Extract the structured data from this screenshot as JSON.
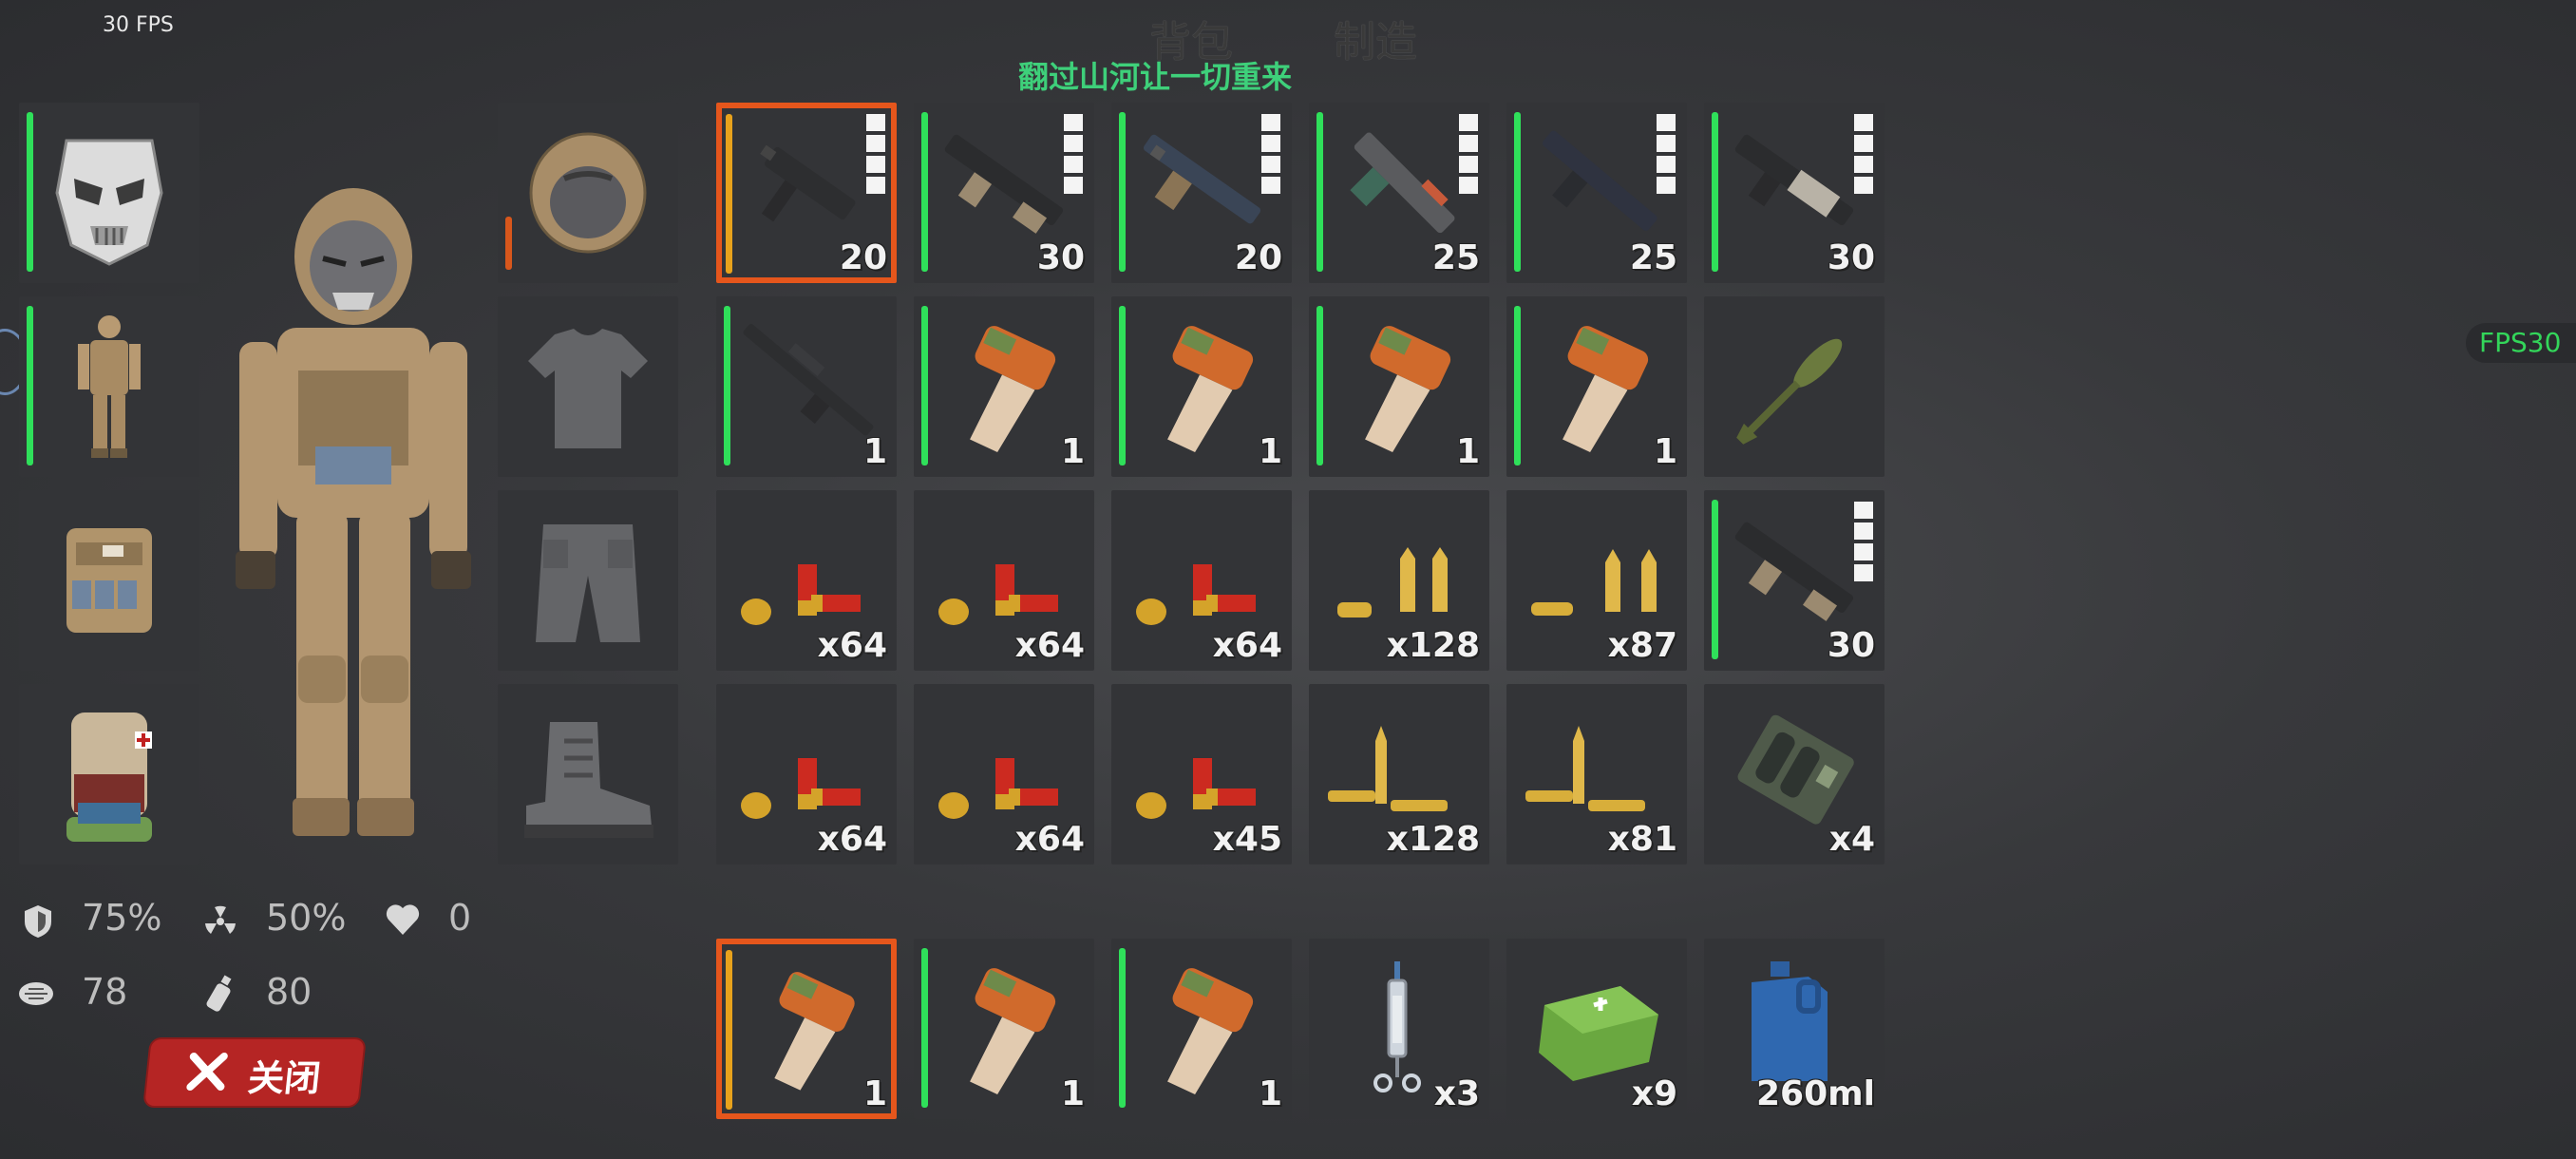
{
  "hud": {
    "fps_top": "30 FPS",
    "fps_right": "FPS30"
  },
  "tabs": {
    "backpack": "背包",
    "crafting": "制造"
  },
  "subtitle": "翻过山河让一切重来",
  "equipment_left": [
    {
      "name": "mask",
      "icon": "skull-mask-icon"
    },
    {
      "name": "suit",
      "icon": "armor-suit-icon"
    },
    {
      "name": "vest",
      "icon": "tactical-vest-icon"
    },
    {
      "name": "backpack",
      "icon": "backpack-icon"
    }
  ],
  "equipment_right": [
    {
      "name": "helmet",
      "icon": "helmet-icon"
    },
    {
      "name": "shirt",
      "icon": "tshirt-icon"
    },
    {
      "name": "pants",
      "icon": "pants-icon"
    },
    {
      "name": "boots",
      "icon": "boot-icon"
    }
  ],
  "stats": {
    "armor": "75%",
    "radiation": "50%",
    "health": "0",
    "food": "78",
    "water": "80"
  },
  "close_button": {
    "label": "关闭"
  },
  "inventory": {
    "row1": [
      "20",
      "30",
      "20",
      "25",
      "25",
      "30"
    ],
    "row2": [
      "1",
      "1",
      "1",
      "1",
      "1",
      ""
    ],
    "row3": [
      "x64",
      "x64",
      "x64",
      "x128",
      "x87",
      "30"
    ],
    "row4": [
      "x64",
      "x64",
      "x45",
      "x128",
      "x81",
      "x4"
    ]
  },
  "hotbar": [
    "1",
    "1",
    "1",
    "x3",
    "x9",
    "260ml"
  ],
  "colors": {
    "selected_border": "#e5561c",
    "durability_bar": "#2fe05a",
    "subtitle": "#3ed07a",
    "fps_right": "#33d65a",
    "close_button": "#b52524"
  }
}
